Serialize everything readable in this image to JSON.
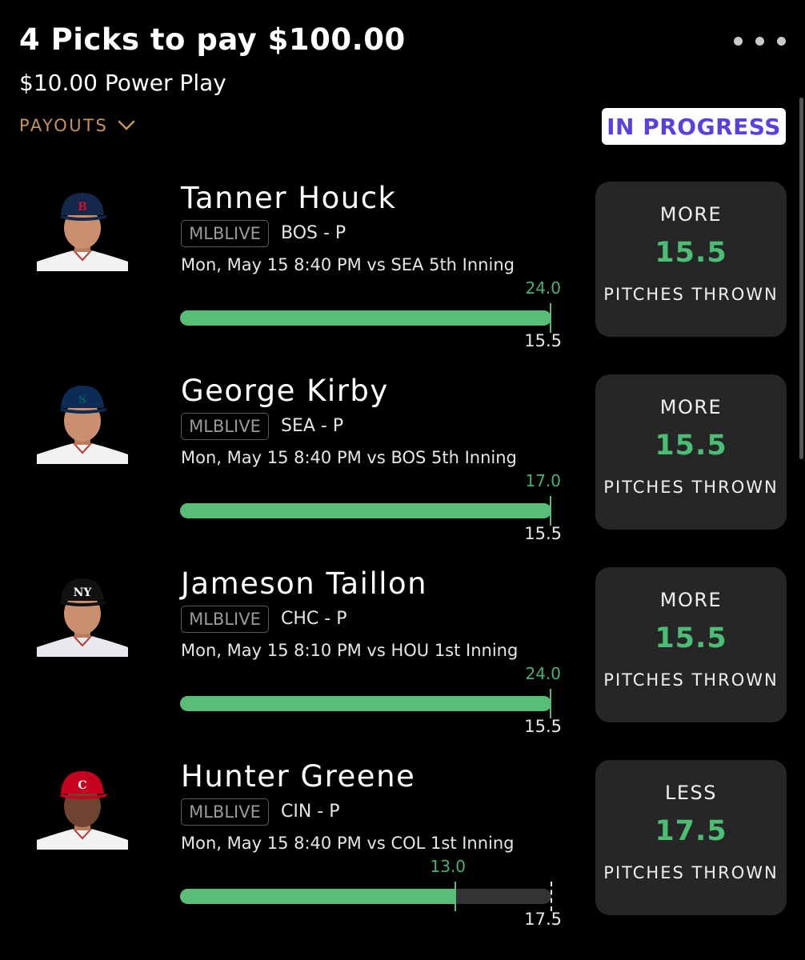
{
  "header": {
    "title": "4 Picks to pay $100.00",
    "subtitle": "$10.00 Power Play",
    "payouts_label": "PAYOUTS",
    "status": "IN PROGRESS"
  },
  "picks": [
    {
      "name": "Tanner Houck",
      "league": "MLBLIVE",
      "team_pos": "BOS - P",
      "game": "Mon, May 15 8:40 PM  vs SEA 5th Inning",
      "actual": "24.0",
      "line": "15.5",
      "direction": "MORE",
      "stat": "PITCHES THROWN",
      "progress": 1.0,
      "cap": "B",
      "cap_color": "#13284a",
      "cap_logo_color": "#c8102e",
      "jersey_color": "#f2f2f2"
    },
    {
      "name": "George Kirby",
      "league": "MLBLIVE",
      "team_pos": "SEA - P",
      "game": "Mon, May 15 8:40 PM  vs BOS 5th Inning",
      "actual": "17.0",
      "line": "15.5",
      "direction": "MORE",
      "stat": "PITCHES THROWN",
      "progress": 1.0,
      "cap": "S",
      "cap_color": "#0c2c56",
      "cap_logo_color": "#005c5c",
      "jersey_color": "#f2f2f2"
    },
    {
      "name": "Jameson Taillon",
      "league": "MLBLIVE",
      "team_pos": "CHC - P",
      "game": "Mon, May 15 8:10 PM  vs HOU 1st Inning",
      "actual": "24.0",
      "line": "15.5",
      "direction": "MORE",
      "stat": "PITCHES THROWN",
      "progress": 1.0,
      "cap": "NY",
      "cap_color": "#111111",
      "cap_logo_color": "#ffffff",
      "jersey_color": "#e8e8ee"
    },
    {
      "name": "Hunter Greene",
      "league": "MLBLIVE",
      "team_pos": "CIN - P",
      "game": "Mon, May 15 8:40 PM  vs COL 1st Inning",
      "actual": "13.0",
      "line": "17.5",
      "direction": "LESS",
      "stat": "PITCHES THROWN",
      "progress": 0.743,
      "cap": "C",
      "cap_color": "#c6011f",
      "cap_logo_color": "#ffffff",
      "jersey_color": "#f2f2f2"
    }
  ]
}
